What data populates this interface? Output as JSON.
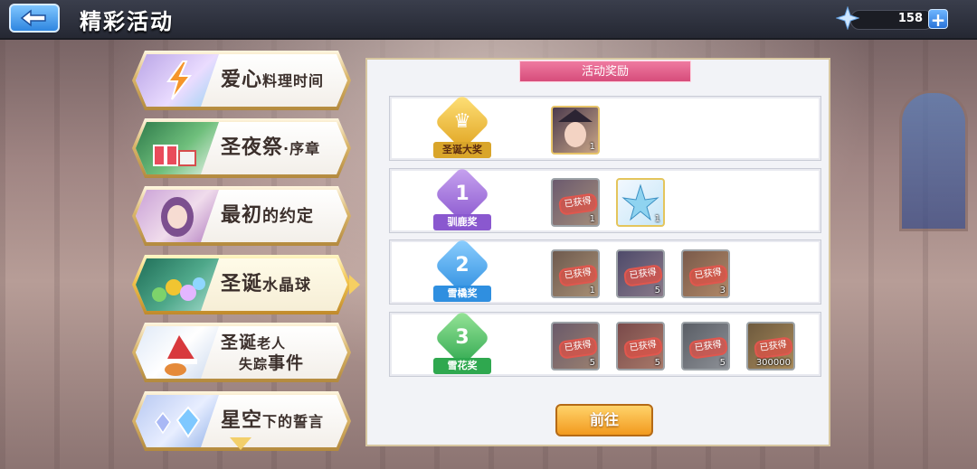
{
  "header": {
    "title": "精彩活动",
    "currency_value": "158",
    "plus_label": "+"
  },
  "events": [
    {
      "label_a": "爱心",
      "label_b": "料理时间"
    },
    {
      "label_a": "圣夜祭",
      "label_b": "·序章"
    },
    {
      "label_a": "最初",
      "label_b": "的约定"
    },
    {
      "label_a": "圣诞",
      "label_b": "水晶球"
    },
    {
      "label_a": "圣诞",
      "label_b": "老人",
      "label_c": "失踪",
      "label_d": "事件"
    },
    {
      "label_a": "星空",
      "label_b": "下的誓言"
    }
  ],
  "panel": {
    "tab_title": "活动奖励",
    "tiers": [
      {
        "medal_num": "",
        "medal_label": "圣诞大奖",
        "items": [
          {
            "count": "1",
            "obtained": false
          }
        ]
      },
      {
        "medal_num": "1",
        "medal_label": "驯鹿奖",
        "items": [
          {
            "count": "1",
            "obtained": true
          },
          {
            "count": "1",
            "obtained": false
          }
        ]
      },
      {
        "medal_num": "2",
        "medal_label": "雪橇奖",
        "items": [
          {
            "count": "1",
            "obtained": true
          },
          {
            "count": "5",
            "obtained": true
          },
          {
            "count": "3",
            "obtained": true
          }
        ]
      },
      {
        "medal_num": "3",
        "medal_label": "雪花奖",
        "items": [
          {
            "count": "5",
            "obtained": true
          },
          {
            "count": "5",
            "obtained": true
          },
          {
            "count": "5",
            "obtained": true
          },
          {
            "count": "300000",
            "obtained": true
          }
        ]
      }
    ],
    "obtained_stamp": "已获得",
    "goto_label": "前往"
  },
  "colors": {
    "gold": "#f2c24b",
    "pink_tab": "#d64d7b",
    "panel_bg": "#f2f3f7",
    "button_orange": "#f29a1f"
  }
}
